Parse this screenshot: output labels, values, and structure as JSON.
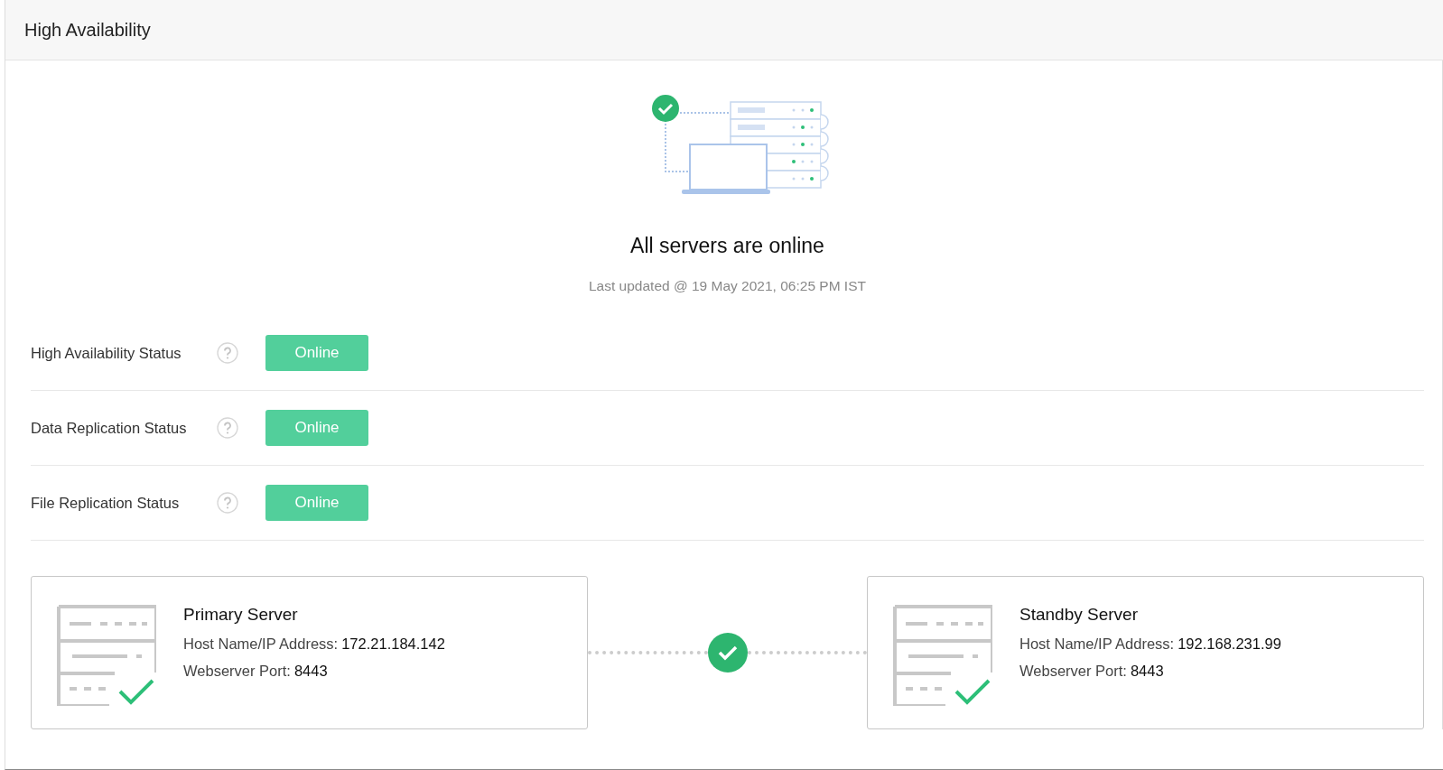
{
  "header": {
    "title": "High Availability"
  },
  "summary": {
    "title": "All servers are online",
    "updated": "Last updated @ 19 May 2021, 06:25 PM IST"
  },
  "statuses": [
    {
      "label": "High Availability Status",
      "kind": "online",
      "value": "Online"
    },
    {
      "label": "Data Replication Status",
      "kind": "online",
      "value": "Online"
    },
    {
      "label": "File Replication Status",
      "kind": "online",
      "value": "Online"
    }
  ],
  "link": {
    "kind": "online"
  },
  "servers": [
    {
      "title": "Primary Server",
      "host_label": "Host Name/IP Address:",
      "host": "172.21.184.142",
      "port_label": "Webserver Port:",
      "port": "8443"
    },
    {
      "title": "Standby Server",
      "host_label": "Host Name/IP Address:",
      "host": "192.168.231.99",
      "port_label": "Webserver Port:",
      "port": "8443"
    }
  ]
}
